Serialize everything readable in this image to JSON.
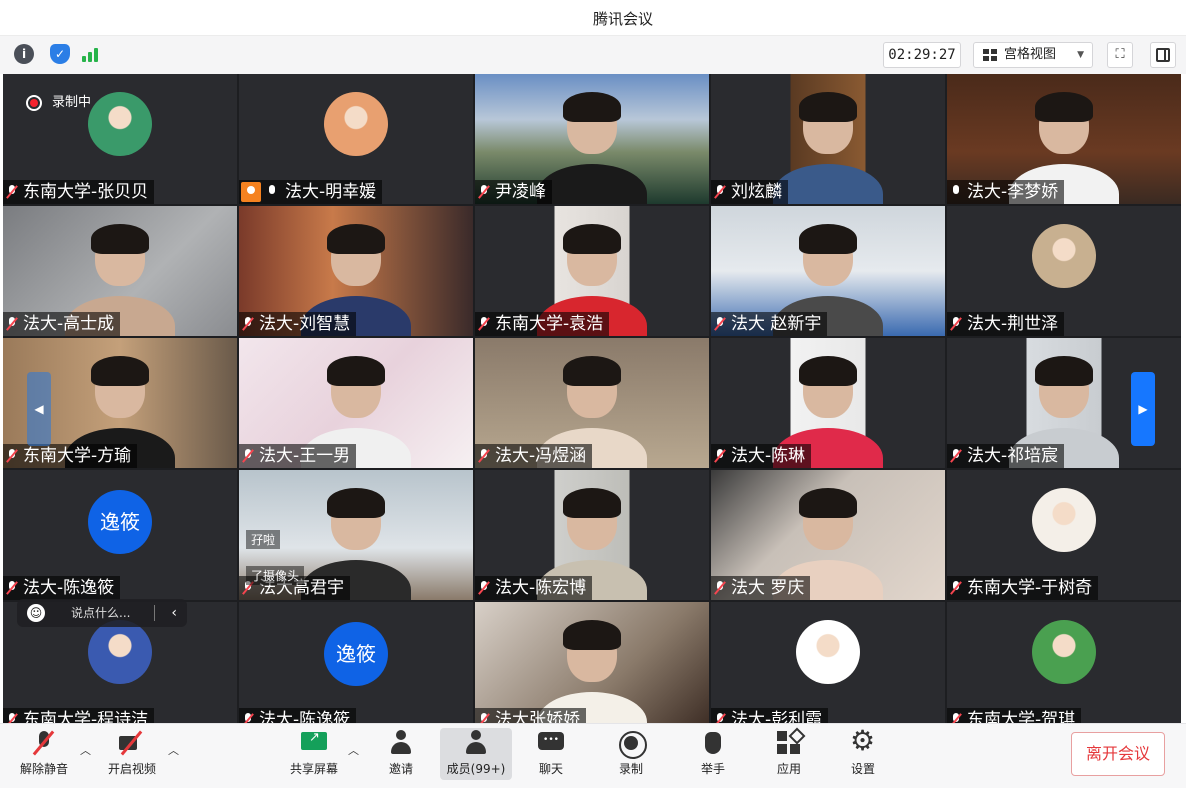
{
  "window": {
    "title": "腾讯会议"
  },
  "topbar": {
    "timer": "02:29:27",
    "view_label": "宫格视图",
    "icons": [
      "info-icon",
      "shield-icon",
      "signal-icon",
      "grid-icon",
      "fullscreen-icon",
      "sidebar-icon"
    ]
  },
  "recording": {
    "label": "录制中"
  },
  "participants": [
    {
      "name": "东南大学-张贝贝",
      "muted": true
    },
    {
      "name": "法大-明幸媛",
      "muted": false,
      "host": true
    },
    {
      "name": "尹凌峰",
      "muted": true
    },
    {
      "name": "刘炫麟",
      "muted": true
    },
    {
      "name": "法大-李梦娇",
      "muted": false
    },
    {
      "name": "法大-高士成",
      "muted": true
    },
    {
      "name": "法大-刘智慧",
      "muted": true
    },
    {
      "name": "东南大学-袁浩",
      "muted": true
    },
    {
      "name": "法大 赵新宇",
      "muted": true
    },
    {
      "name": "法大-荆世泽",
      "muted": true
    },
    {
      "name": "东南大学-方瑜",
      "muted": true
    },
    {
      "name": "法大-王一男",
      "muted": true
    },
    {
      "name": "法大-冯煜涵",
      "muted": true
    },
    {
      "name": "法大-陈琳",
      "muted": true
    },
    {
      "name": "法大-祁培宸",
      "muted": true
    },
    {
      "name": "法大-陈逸筱",
      "muted": true,
      "avatar_text": "逸筱"
    },
    {
      "name": "法大高君宇",
      "muted": true
    },
    {
      "name": "法大-陈宏博",
      "muted": true
    },
    {
      "name": "法大 罗庆",
      "muted": true
    },
    {
      "name": "东南大学-于树奇",
      "muted": true
    },
    {
      "name": "东南大学-程诗洁",
      "muted": true
    },
    {
      "name": "法大-陈逸筱",
      "muted": true,
      "avatar_text": "逸筱"
    },
    {
      "name": "法大张娇娇",
      "muted": true
    },
    {
      "name": "法大-彭利霞",
      "muted": true
    },
    {
      "name": "东南大学-贺琪",
      "muted": true
    }
  ],
  "chat": {
    "messages": [
      "孖啦",
      "了摄像头"
    ],
    "input_placeholder": "说点什么..."
  },
  "controls": {
    "unmute": "解除静音",
    "video": "开启视频",
    "share": "共享屏幕",
    "invite": "邀请",
    "members": "成员(99+)",
    "chat": "聊天",
    "record": "录制",
    "raise_hand": "举手",
    "apps": "应用",
    "settings": "设置",
    "leave": "离开会议"
  },
  "colors": {
    "accent": "#1677ff",
    "leave": "#e5383b",
    "share_green": "#14a05a",
    "grid_bg": "#1d1e21"
  }
}
